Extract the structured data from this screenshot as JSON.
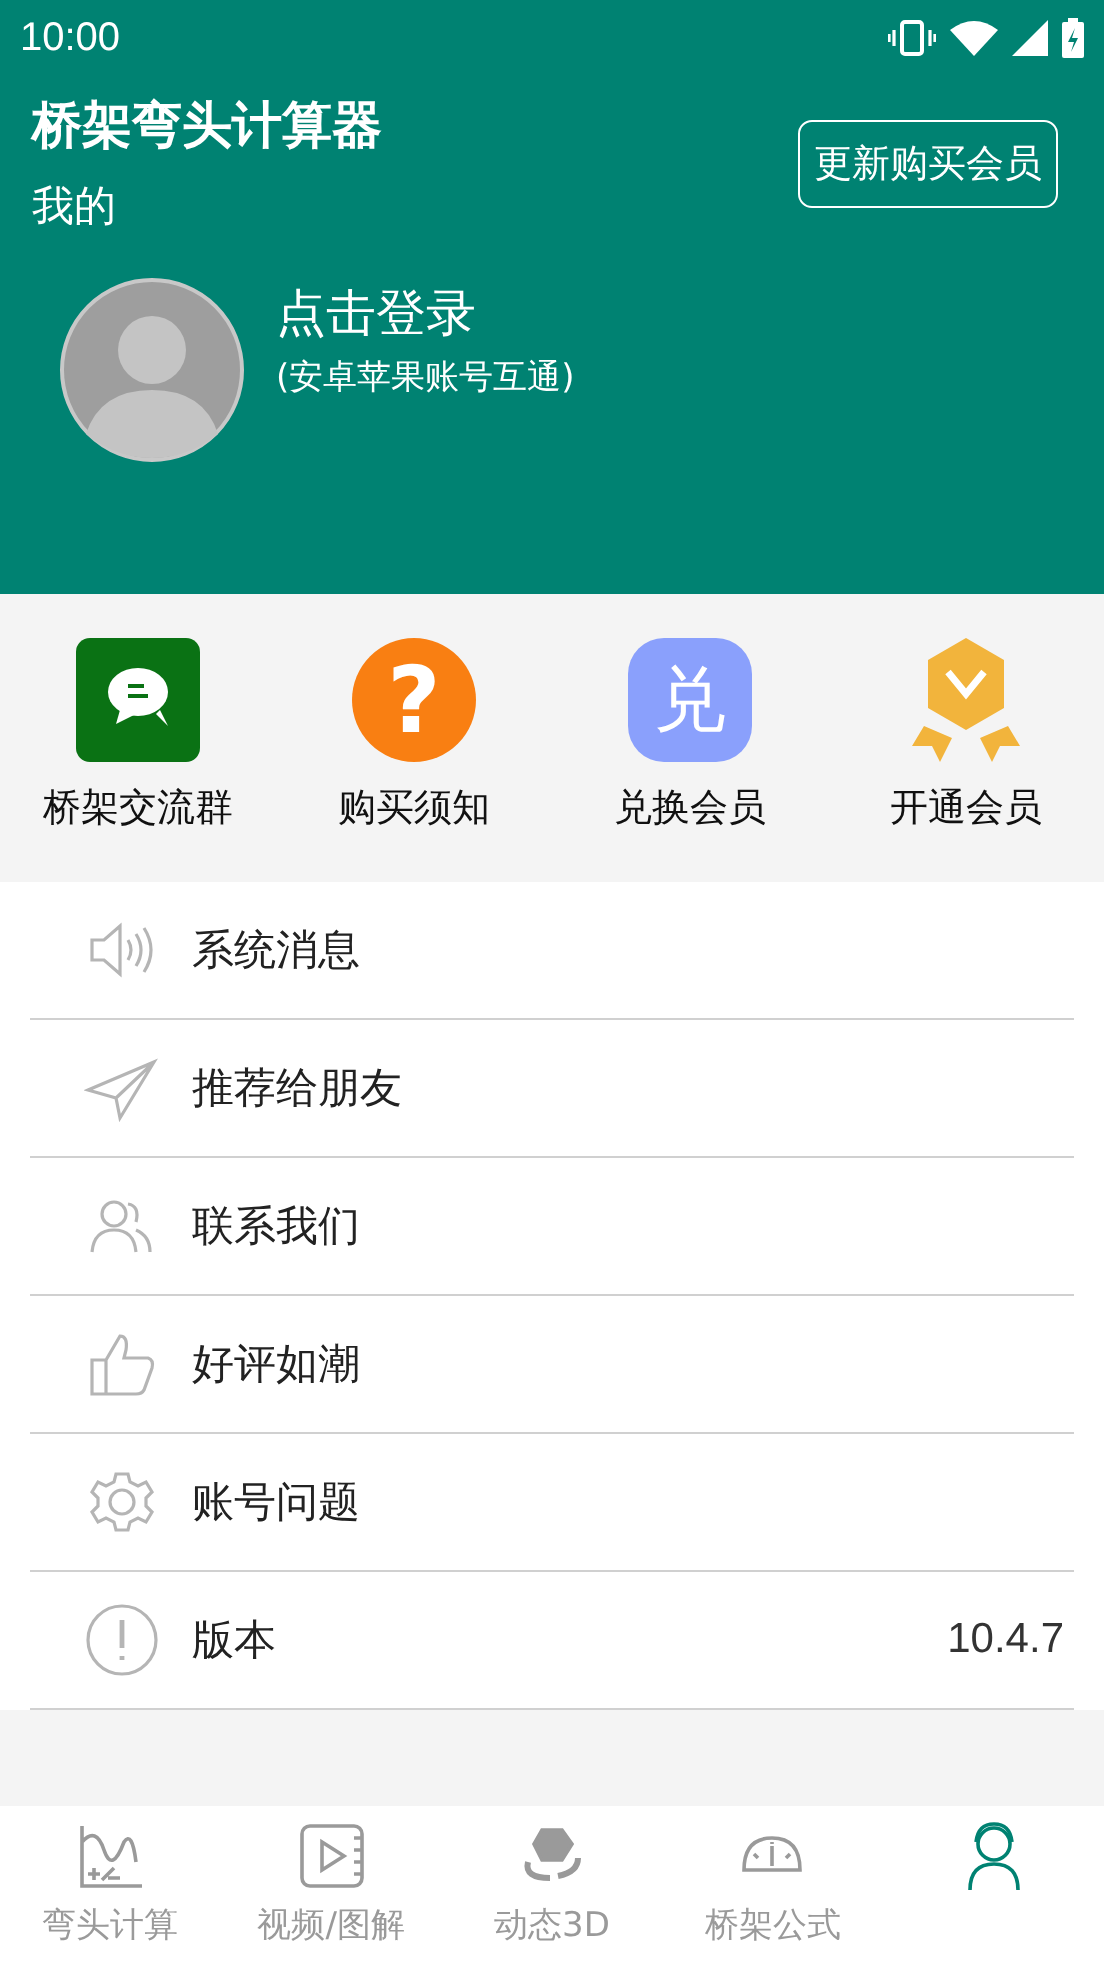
{
  "status_bar": {
    "time": "10:00"
  },
  "header": {
    "title": "桥架弯头计算器",
    "subtitle": "我的",
    "renew_button": "更新购买会员"
  },
  "profile": {
    "login": "点击登录",
    "note": "(安卓苹果账号互通)"
  },
  "quick_actions": [
    {
      "kind": "chat",
      "label": "桥架交流群"
    },
    {
      "kind": "question",
      "glyph": "?",
      "label": "购买须知"
    },
    {
      "kind": "redeem",
      "glyph": "兑",
      "label": "兑换会员"
    },
    {
      "kind": "medal",
      "label": "开通会员"
    }
  ],
  "menu": [
    {
      "kind": "speaker",
      "label": "系统消息"
    },
    {
      "kind": "plane",
      "label": "推荐给朋友"
    },
    {
      "kind": "people",
      "label": "联系我们"
    },
    {
      "kind": "thumb",
      "label": "好评如潮"
    },
    {
      "kind": "gear",
      "label": "账号问题"
    },
    {
      "kind": "info",
      "label": "版本",
      "value": "10.4.7"
    }
  ],
  "tabs": [
    {
      "kind": "curve",
      "label": "弯头计算",
      "selected": false
    },
    {
      "kind": "video",
      "label": "视频/图解",
      "selected": false
    },
    {
      "kind": "cube",
      "label": "动态3D",
      "selected": false
    },
    {
      "kind": "gauge",
      "label": "桥架公式",
      "selected": false
    },
    {
      "kind": "person",
      "selected": true
    }
  ]
}
